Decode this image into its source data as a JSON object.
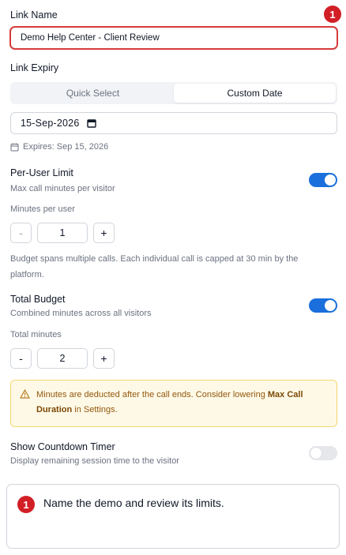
{
  "link_name": {
    "label": "Link Name",
    "value": "Demo Help Center - Client Review",
    "step_badge": "1"
  },
  "link_expiry": {
    "label": "Link Expiry",
    "tabs": [
      {
        "label": "Quick Select",
        "active": false
      },
      {
        "label": "Custom Date",
        "active": true
      }
    ],
    "date_value": "15-Sep-2026",
    "expires_text": "Expires: Sep 15, 2026"
  },
  "per_user_limit": {
    "title": "Per-User Limit",
    "subtitle": "Max call minutes per visitor",
    "enabled": true,
    "field_label": "Minutes per user",
    "minus": "-",
    "value": "1",
    "plus": "+",
    "note": "Budget spans multiple calls. Each individual call is capped at 30 min by the platform."
  },
  "total_budget": {
    "title": "Total Budget",
    "subtitle": "Combined minutes across all visitors",
    "enabled": true,
    "field_label": "Total minutes",
    "minus": "-",
    "value": "2",
    "plus": "+"
  },
  "warning": {
    "text_before": "Minutes are deducted after the call ends. Consider lowering ",
    "bold": "Max Call Duration",
    "text_after": " in Settings.",
    "icon": "warning-triangle-icon"
  },
  "countdown": {
    "title": "Show Countdown Timer",
    "subtitle": "Display remaining session time to the visitor",
    "enabled": false
  },
  "instruction": {
    "badge": "1",
    "text": "Name the demo and review its limits."
  },
  "colors": {
    "accent": "#1a6fdc",
    "badge": "#d21f26",
    "warning_bg": "#fef9e7",
    "warning_border": "#f5d76e"
  }
}
